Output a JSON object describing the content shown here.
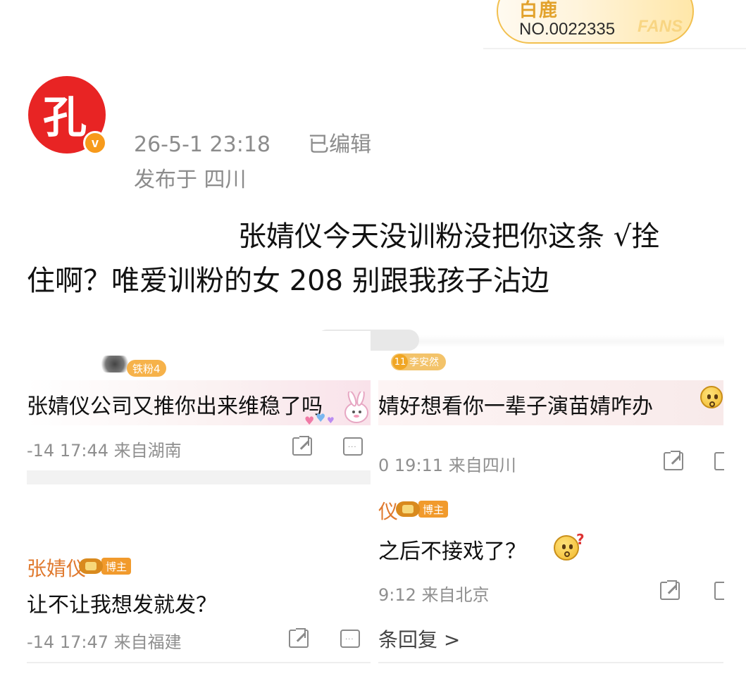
{
  "fans_badge": {
    "brand": "白鹿",
    "number": "NO.0022335",
    "fans_word": "FANS"
  },
  "post": {
    "author_avatar_char": "孔",
    "verified_mark": "v",
    "time": "26-5-1 23:18",
    "edited": "已编辑",
    "location": "发布于 四川",
    "body_line1": "张婧仪今天没训粉没把你这条 √拴",
    "body_line2": "住啊？唯爱训粉的女 208 别跟我孩子沾边"
  },
  "left_card": {
    "c1": {
      "tag": "铁粉4",
      "text": "张婧仪公司又推你出来维稳了吗",
      "time": "-14 17:44 来自湖南"
    },
    "c2": {
      "name": "张婧仪",
      "badge": "博主",
      "text": "让不让我想发就发？",
      "time": "-14 17:47 来自福建"
    }
  },
  "right_card": {
    "c1": {
      "fan_level": "11",
      "fan_name": "李安然",
      "text": "婧好想看你一辈子演苗婧咋办",
      "time": "0 19:11 来自四川"
    },
    "c2": {
      "name": "仪",
      "badge": "博主",
      "text": "之后不接戏了？",
      "time": "9:12 来自北京",
      "replies": "条回复 >"
    }
  },
  "colors": {
    "avatar": "#e82424",
    "verified": "#f79a1b",
    "badge": "#f19a2c",
    "meta_grey": "#8c8c8c"
  },
  "icons": [
    "share-icon",
    "comment-icon",
    "verified-icon",
    "crown-icon",
    "thinking-emoji",
    "sad-emoji",
    "bunny-sticker"
  ]
}
